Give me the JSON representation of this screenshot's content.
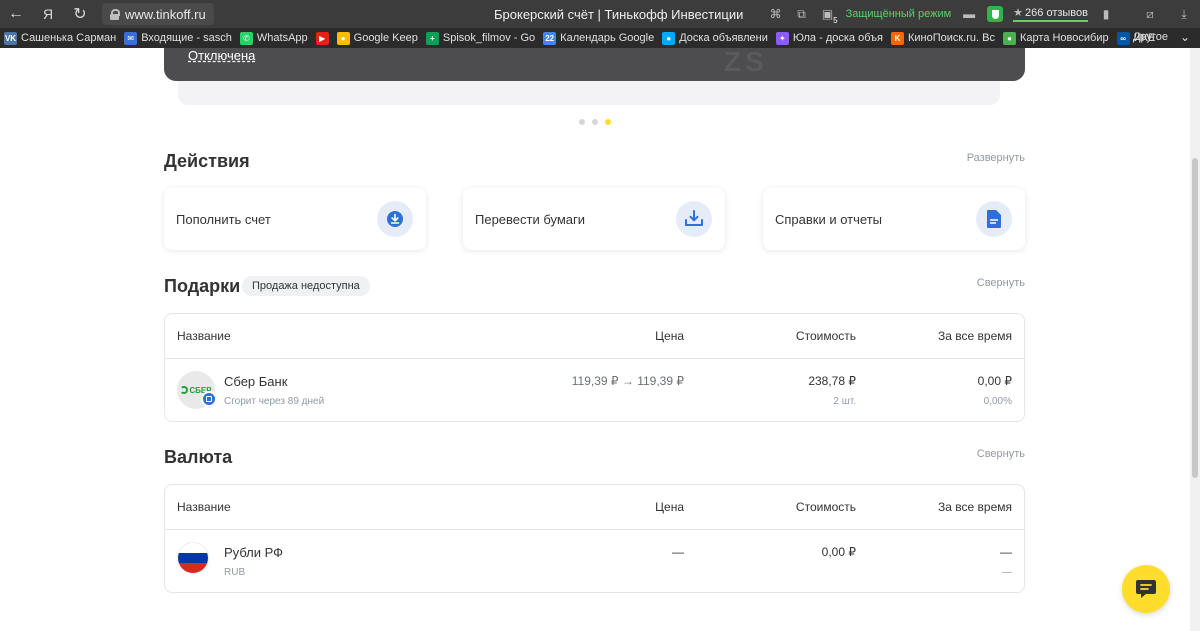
{
  "browser": {
    "url": "www.tinkoff.ru",
    "tab_title": "Брокерский счёт | Тинькофф Инвестиции",
    "secure_mode": "Защищённый режим",
    "reviews": "266 отзывов",
    "tab_count": "5",
    "bookmarks": [
      {
        "label": "Сашенька Сарман",
        "icon": "vk-icon",
        "color": "#4a76a8",
        "glyph": "VK"
      },
      {
        "label": "Входящие - sasch",
        "icon": "mail-icon",
        "color": "#3b6fd8",
        "glyph": "✉"
      },
      {
        "label": "WhatsApp",
        "icon": "whatsapp-icon",
        "color": "#25d366",
        "glyph": "✆"
      },
      {
        "label": "",
        "icon": "youtube-icon",
        "color": "#e62117",
        "glyph": "▶"
      },
      {
        "label": "Google Keep",
        "icon": "keep-icon",
        "color": "#fbbc04",
        "glyph": "●"
      },
      {
        "label": "Spisok_filmov - Go",
        "icon": "sheets-icon",
        "color": "#0f9d58",
        "glyph": "+"
      },
      {
        "label": "Календарь Google",
        "icon": "calendar-icon",
        "color": "#4285f4",
        "glyph": "22"
      },
      {
        "label": "Доска объявлени",
        "icon": "avito-icon",
        "color": "#00aaff",
        "glyph": "●"
      },
      {
        "label": "Юла - доска объя",
        "icon": "youla-icon",
        "color": "#8b5cf6",
        "glyph": "✦"
      },
      {
        "label": "КиноПоиск.ru. Вс",
        "icon": "kinopoisk-icon",
        "color": "#ff6600",
        "glyph": "K"
      },
      {
        "label": "Карта Новосибир",
        "icon": "map-icon",
        "color": "#4caf50",
        "glyph": "●"
      },
      {
        "label": "ИКЕ",
        "icon": "ikea-icon",
        "color": "#0058a3",
        "glyph": "∞"
      }
    ],
    "other": "Другое"
  },
  "banner": {
    "status_text": "Отключена"
  },
  "actions": {
    "title": "Действия",
    "expand_link": "Развернуть",
    "cards": [
      {
        "label": "Пополнить счет",
        "icon": "download-circle-icon"
      },
      {
        "label": "Перевести бумаги",
        "icon": "tray-download-icon"
      },
      {
        "label": "Справки и отчеты",
        "icon": "document-icon"
      }
    ]
  },
  "gifts": {
    "title": "Подарки",
    "badge": "Продажа недоступна",
    "collapse_link": "Свернуть",
    "columns": [
      "Название",
      "Цена",
      "Стоимость",
      "За все время"
    ],
    "rows": [
      {
        "name": "Сбер Банк",
        "logo_text": "СБЕР",
        "subtitle": "Сгорит через 89 дней",
        "price": "119,39 ₽ → 119,39 ₽",
        "cost": "238,78 ₽",
        "qty": "2 шт.",
        "total": "0,00 ₽",
        "total_pct": "0,00%"
      }
    ]
  },
  "currency": {
    "title": "Валюта",
    "collapse_link": "Свернуть",
    "columns": [
      "Название",
      "Цена",
      "Стоимость",
      "За все время"
    ],
    "rows": [
      {
        "name": "Рубли РФ",
        "subtitle": "RUB",
        "price": "—",
        "cost": "0,00 ₽",
        "total": "—",
        "total_sub": "—"
      }
    ]
  },
  "colors": {
    "accent_yellow": "#ffdd2d",
    "icon_blue": "#2f6fdc",
    "sber_green": "#21a038"
  }
}
